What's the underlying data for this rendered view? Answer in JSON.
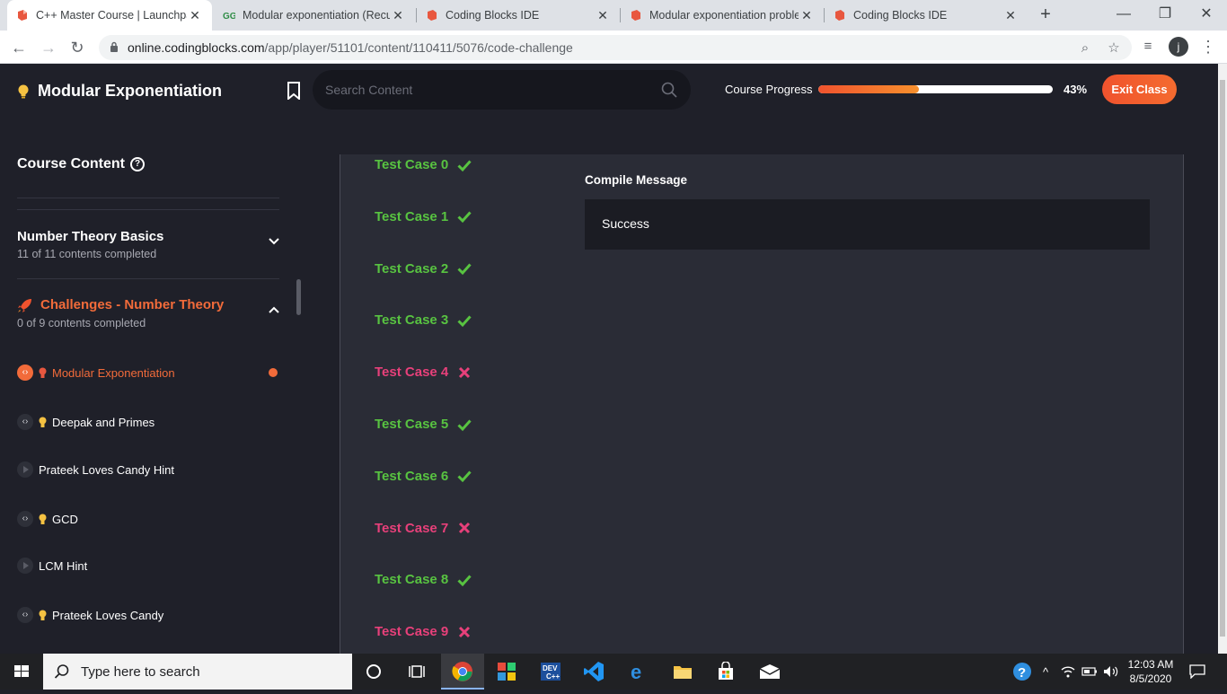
{
  "browser": {
    "tabs": [
      {
        "title": "C++ Master Course | Launchpa",
        "active": true
      },
      {
        "title": "Modular exponentiation (Recu",
        "active": false
      },
      {
        "title": "Coding Blocks IDE",
        "active": false
      },
      {
        "title": "Modular exponentiation proble",
        "active": false
      },
      {
        "title": "Coding Blocks IDE",
        "active": false
      }
    ],
    "url_host": "online.codingblocks.com",
    "url_path": "/app/player/51101/content/110411/5076/code-challenge",
    "profile_initial": "j"
  },
  "header": {
    "title": "Modular Exponentiation",
    "search_placeholder": "Search Content",
    "progress_label": "Course Progress",
    "progress_value": 43,
    "progress_text": "43%",
    "exit_label": "Exit Class"
  },
  "sidebar": {
    "heading": "Course Content",
    "sections": [
      {
        "title": "Number Theory Basics",
        "subtitle": "11 of 11 contents completed",
        "expanded": false
      },
      {
        "title": "Challenges - Number Theory",
        "subtitle": "0 of 9 contents completed",
        "expanded": true
      }
    ],
    "items": [
      {
        "label": "Modular Exponentiation",
        "type": "code",
        "bulb": true,
        "active": true
      },
      {
        "label": "Deepak and Primes",
        "type": "code",
        "bulb": true,
        "active": false
      },
      {
        "label": "Prateek Loves Candy Hint",
        "type": "play",
        "bulb": false,
        "active": false
      },
      {
        "label": "GCD",
        "type": "code",
        "bulb": true,
        "active": false
      },
      {
        "label": "LCM Hint",
        "type": "play",
        "bulb": false,
        "active": false
      },
      {
        "label": "Prateek Loves Candy",
        "type": "code",
        "bulb": true,
        "active": false
      }
    ]
  },
  "results": {
    "test_cases": [
      {
        "label": "Test Case 0",
        "passed": true
      },
      {
        "label": "Test Case 1",
        "passed": true
      },
      {
        "label": "Test Case 2",
        "passed": true
      },
      {
        "label": "Test Case 3",
        "passed": true
      },
      {
        "label": "Test Case 4",
        "passed": false
      },
      {
        "label": "Test Case 5",
        "passed": true
      },
      {
        "label": "Test Case 6",
        "passed": true
      },
      {
        "label": "Test Case 7",
        "passed": false
      },
      {
        "label": "Test Case 8",
        "passed": true
      },
      {
        "label": "Test Case 9",
        "passed": false
      }
    ],
    "compile_label": "Compile Message",
    "compile_message": "Success"
  },
  "taskbar": {
    "search_placeholder": "Type here to search",
    "time": "12:03 AM",
    "date": "8/5/2020"
  },
  "colors": {
    "accent": "#f26b3a",
    "pass": "#58c341",
    "fail": "#e7407a",
    "background": "#1f2029",
    "panel": "#2a2c36"
  }
}
